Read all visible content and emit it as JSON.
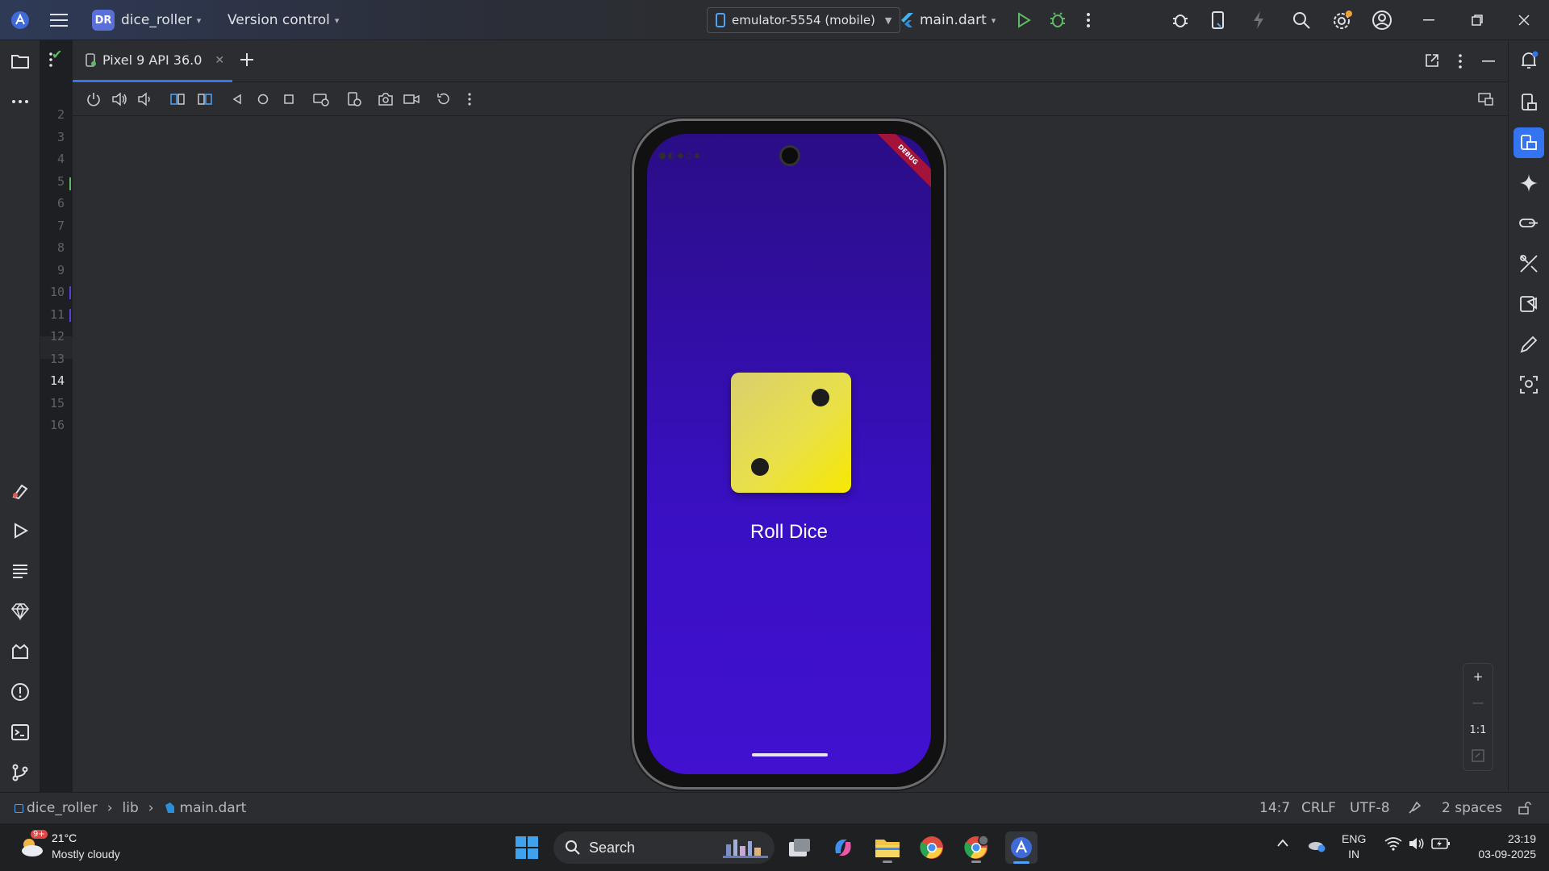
{
  "titlebar": {
    "project_badge": "DR",
    "project_name": "dice_roller",
    "version_control": "Version control",
    "device": "emulator-5554 (mobile)",
    "run_config": "main.dart"
  },
  "tool_window": {
    "tab_label": "Pixel 9 API 36.0"
  },
  "editor": {
    "line_numbers": [
      "2",
      "3",
      "4",
      "5",
      "6",
      "7",
      "8",
      "9",
      "10",
      "11",
      "12",
      "13",
      "14",
      "15",
      "16"
    ],
    "current_line": "14"
  },
  "app": {
    "roll_button_label": "Roll Dice",
    "debug_banner": "DEBUG",
    "dice_face": 2,
    "gradient_colors": [
      "#2a0d86",
      "#4111cf"
    ],
    "dice_color": "#f6e800"
  },
  "zoom": {
    "plus": "+",
    "minus": "—",
    "one_to_one": "1:1"
  },
  "statusbar": {
    "breadcrumb": [
      "dice_roller",
      "lib",
      "main.dart"
    ],
    "cursor_position": "14:7",
    "line_ending": "CRLF",
    "encoding": "UTF-8",
    "indent": "2 spaces"
  },
  "taskbar": {
    "weather_temp": "21°C",
    "weather_desc": "Mostly cloudy",
    "weather_badge": "9+",
    "search_label": "Search",
    "language_top": "ENG",
    "language_bottom": "IN",
    "time": "23:19",
    "date": "03-09-2025"
  },
  "colors": {
    "accent": "#3574f0",
    "run_green": "#5fb865",
    "notification": "#f0a030"
  }
}
